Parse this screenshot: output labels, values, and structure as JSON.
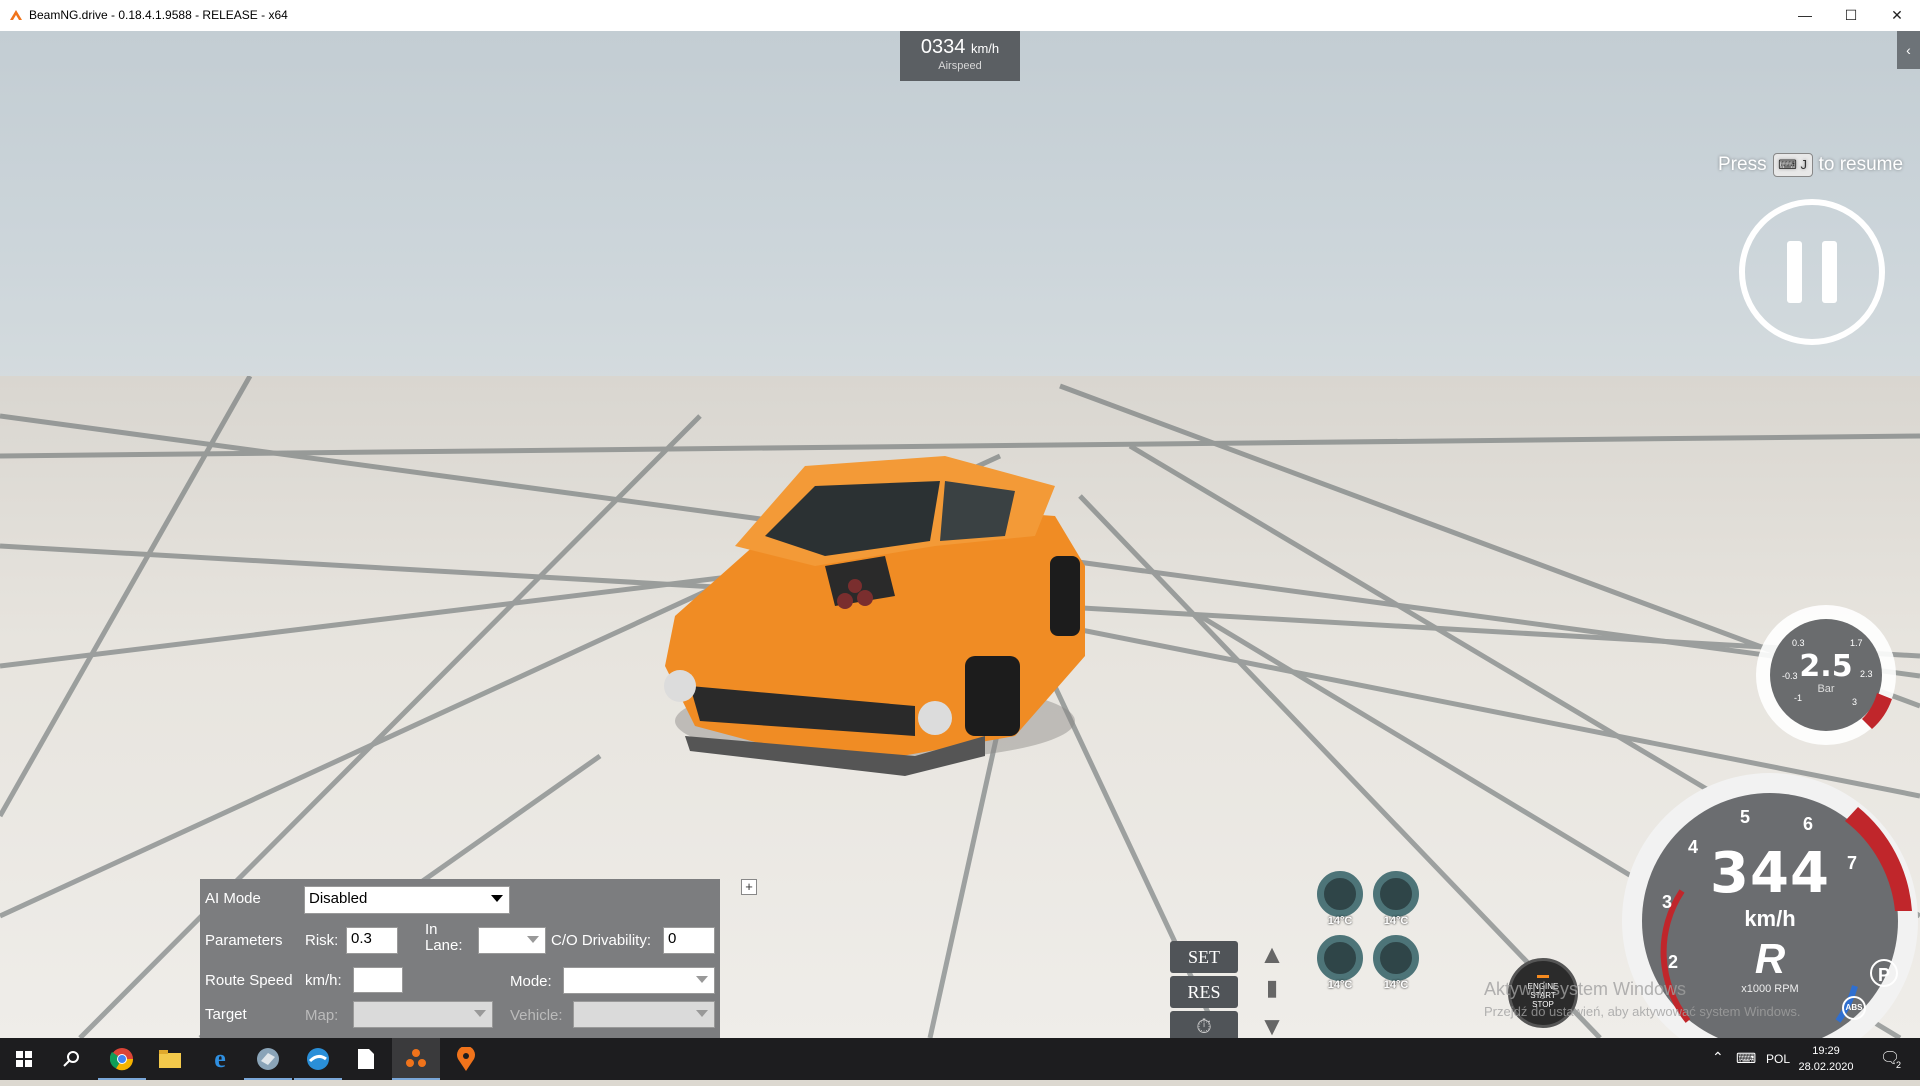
{
  "window": {
    "title": "BeamNG.drive - 0.18.4.1.9588 - RELEASE - x64",
    "minimize": "—",
    "maximize": "☐",
    "close": "✕"
  },
  "hud": {
    "airspeed_value": "0334",
    "airspeed_unit": "km/h",
    "airspeed_label": "Airspeed",
    "right_tab_icon": "‹",
    "resume_press": "Press",
    "resume_key": "⌨ J",
    "resume_text": "to resume",
    "boost_value": "2.5",
    "boost_unit": "Bar",
    "boost_ticks": [
      "-1",
      "-0.3",
      "0.3",
      "1.7",
      "2.3",
      "3"
    ],
    "speed_value": "344",
    "speed_unit": "km/h",
    "gear": "R",
    "rpm_label": "x1000 RPM",
    "rpm_ticks": [
      "2",
      "3",
      "4",
      "5",
      "6",
      "7"
    ],
    "parking_brake": "P",
    "abs_label": "ABS",
    "cruise_set": "SET",
    "cruise_res": "RES",
    "cruise_icon": "⏱",
    "tyre_temps": [
      "14°C",
      "14°C",
      "14°C",
      "14°C"
    ],
    "engine_line1": "ENGINE",
    "engine_line2": "START",
    "engine_line3": "STOP",
    "watermark_line1": "Aktywuj system Windows",
    "watermark_line2": "Przejdź do ustawień, aby aktywować system Windows."
  },
  "ai_panel": {
    "ai_mode_label": "AI Mode",
    "ai_mode_value": "Disabled",
    "parameters_label": "Parameters",
    "risk_label": "Risk:",
    "risk_value": "0.3",
    "in_lane_label": "In Lane:",
    "drivability_label": "C/O Drivability:",
    "drivability_value": "0",
    "route_speed_label": "Route Speed",
    "kmh_label": "km/h:",
    "route_speed_value": "",
    "mode_label": "Mode:",
    "target_label": "Target",
    "map_label": "Map:",
    "vehicle_label": "Vehicle:",
    "expand_button": "+"
  },
  "taskbar": {
    "items": [
      "windows-start",
      "search",
      "chrome",
      "file-explorer",
      "edge",
      "app-bird",
      "app-wave",
      "notes",
      "beamng",
      "app-pin"
    ],
    "lang": "POL",
    "time": "19:29",
    "date": "28.02.2020",
    "notifications": "2"
  },
  "colors": {
    "car_orange": "#f08c24",
    "hud_red": "#c0262b",
    "hud_blue": "#2f6fd0",
    "panel_grey": "#7c7d7f"
  }
}
